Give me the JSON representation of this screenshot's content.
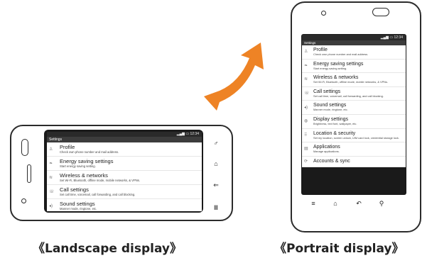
{
  "colors": {
    "arrow": "#ee8325",
    "frame": "#2b2b2b",
    "screen_bg": "#1a1a1a"
  },
  "status_bar": {
    "time": "12:34"
  },
  "settings_header": "Settings",
  "landscape_items": [
    {
      "icon": "profile-icon",
      "title": "Profile",
      "desc": "Check own phone number and mail address."
    },
    {
      "icon": "energy-icon",
      "title": "Energy saving settings",
      "desc": "Start energy saving setting."
    },
    {
      "icon": "wifi-icon",
      "title": "Wireless & networks",
      "desc": "Set Wi-Fi, Bluetooth, offline mode, mobile networks, & VPNs."
    },
    {
      "icon": "call-icon",
      "title": "Call settings",
      "desc": "Set call time, voicemail, call forwarding, and call blocking."
    },
    {
      "icon": "sound-icon",
      "title": "Sound settings",
      "desc": "Manner mode, ringtone, etc."
    }
  ],
  "portrait_items": [
    {
      "icon": "profile-icon",
      "title": "Profile",
      "desc": "Check own phone number and mail address."
    },
    {
      "icon": "energy-icon",
      "title": "Energy saving settings",
      "desc": "Start energy saving setting."
    },
    {
      "icon": "wifi-icon",
      "title": "Wireless & networks",
      "desc": "Set Wi-Fi, Bluetooth, offline mode, mobile networks, & VPNs."
    },
    {
      "icon": "call-icon",
      "title": "Call settings",
      "desc": "Set call time, voicemail, call forwarding, and call blocking."
    },
    {
      "icon": "sound-icon",
      "title": "Sound settings",
      "desc": "Manner mode, ringtone, etc."
    },
    {
      "icon": "display-icon",
      "title": "Display settings",
      "desc": "Brightness, text font, wallpaper, etc."
    },
    {
      "icon": "security-icon",
      "title": "Location & security",
      "desc": "Set my location, screen unlock, UIM card lock, credential storage lock."
    },
    {
      "icon": "applications-icon",
      "title": "Applications",
      "desc": "Manage applications."
    },
    {
      "icon": "accounts-icon",
      "title": "Accounts & sync",
      "desc": ""
    }
  ],
  "captions": {
    "landscape": "《Landscape display》",
    "portrait": "《Portrait display》"
  }
}
